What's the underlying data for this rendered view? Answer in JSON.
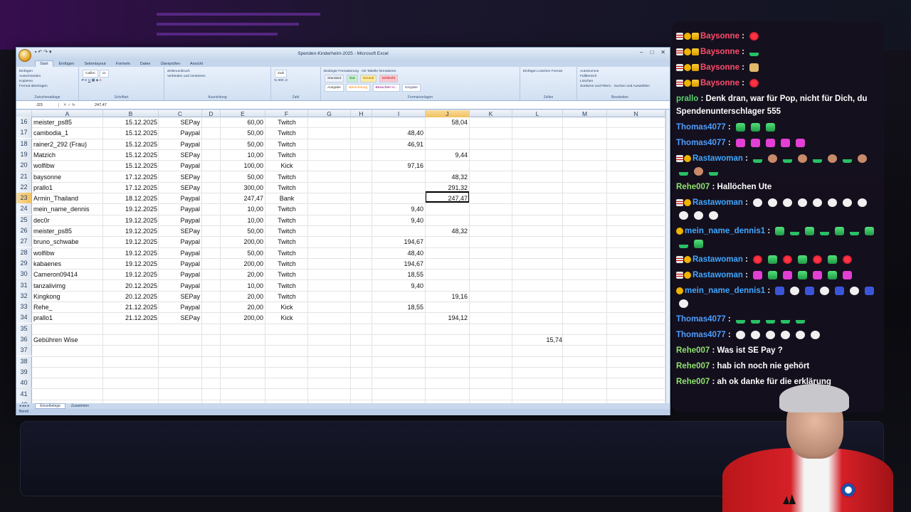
{
  "excel": {
    "title": "Spenden-Kinderheim-2025 - Microsoft Excel",
    "ribbon_tabs": [
      "Start",
      "Einfügen",
      "Seitenlayout",
      "Formeln",
      "Daten",
      "Überprüfen",
      "Ansicht"
    ],
    "clipboard": {
      "paste": "Einfügen",
      "cut": "Ausschneiden",
      "copy": "Kopieren",
      "format": "Format übertragen",
      "group": "Zwischenablage"
    },
    "font": {
      "name": "Calibri",
      "size": "11",
      "group": "Schriftart"
    },
    "alignment": {
      "wrap": "Zeilenumbruch",
      "merge": "Verbinden und zentrieren",
      "group": "Ausrichtung"
    },
    "number": {
      "format": "Zahl",
      "group": "Zahl"
    },
    "styles": {
      "cond": "Bedingte Formatierung",
      "table": "Als Tabelle formatieren",
      "standard": "Standard",
      "gut": "Gut",
      "neutral": "Neutral",
      "schlecht": "Schlecht",
      "ausgabe": "Ausgabe",
      "berechnung": "Berechnung",
      "besucht": "Besuchter H...",
      "eingabe": "Eingabe",
      "group": "Formatvorlagen"
    },
    "cells": {
      "insert": "Einfügen",
      "delete": "Löschen",
      "format": "Format",
      "group": "Zellen"
    },
    "editing": {
      "autosum": "AutoSumme",
      "fill": "Füllbereich",
      "clear": "Löschen",
      "sort": "Sortieren und Filtern",
      "find": "Suchen und Auswählen",
      "group": "Bearbeiten"
    },
    "namebox": "J23",
    "formula": "247,47",
    "columns": [
      "A",
      "B",
      "C",
      "D",
      "E",
      "F",
      "G",
      "H",
      "I",
      "J",
      "K",
      "L",
      "M",
      "N"
    ],
    "rows": [
      {
        "n": "16",
        "a": "meister_ps85",
        "b": "15.12.2025",
        "c": "SEPay",
        "e": "60,00",
        "f": "Twitch",
        "i": "",
        "j": "58,04",
        "l": ""
      },
      {
        "n": "17",
        "a": "cambodia_1",
        "b": "15.12.2025",
        "c": "Paypal",
        "e": "50,00",
        "f": "Twitch",
        "i": "48,40",
        "j": "",
        "l": ""
      },
      {
        "n": "18",
        "a": "rainer2_292 (Frau)",
        "b": "15.12.2025",
        "c": "Paypal",
        "e": "50,00",
        "f": "Twitch",
        "i": "46,91",
        "j": "",
        "l": ""
      },
      {
        "n": "19",
        "a": "Matzich",
        "b": "15.12.2025",
        "c": "SEPay",
        "e": "10,00",
        "f": "Twitch",
        "i": "",
        "j": "9,44",
        "l": ""
      },
      {
        "n": "20",
        "a": "wolfibw",
        "b": "15.12.2025",
        "c": "Paypal",
        "e": "100,00",
        "f": "Kick",
        "i": "97,16",
        "j": "",
        "l": ""
      },
      {
        "n": "21",
        "a": "baysonne",
        "b": "17.12.2025",
        "c": "SEPay",
        "e": "50,00",
        "f": "Twitch",
        "i": "",
        "j": "48,32",
        "l": ""
      },
      {
        "n": "22",
        "a": "prallo1",
        "b": "17.12.2025",
        "c": "SEPay",
        "e": "300,00",
        "f": "Twitch",
        "i": "",
        "j": "291,32",
        "l": ""
      },
      {
        "n": "23",
        "a": "Armin_Thailand",
        "b": "18.12.2025",
        "c": "Paypal",
        "e": "247,47",
        "f": "Bank",
        "i": "",
        "j": "247,47",
        "l": ""
      },
      {
        "n": "24",
        "a": "mein_name_dennis",
        "b": "19.12.2025",
        "c": "Paypal",
        "e": "10,00",
        "f": "Twitch",
        "i": "9,40",
        "j": "",
        "l": ""
      },
      {
        "n": "25",
        "a": "dec0r",
        "b": "19.12.2025",
        "c": "Paypal",
        "e": "10,00",
        "f": "Twitch",
        "i": "9,40",
        "j": "",
        "l": ""
      },
      {
        "n": "26",
        "a": "meister_ps85",
        "b": "19.12.2025",
        "c": "SEPay",
        "e": "50,00",
        "f": "Twitch",
        "i": "",
        "j": "48,32",
        "l": ""
      },
      {
        "n": "27",
        "a": "bruno_schwabe",
        "b": "19.12.2025",
        "c": "Paypal",
        "e": "200,00",
        "f": "Twitch",
        "i": "194,67",
        "j": "",
        "l": ""
      },
      {
        "n": "28",
        "a": "wolfibw",
        "b": "19.12.2025",
        "c": "Paypal",
        "e": "50,00",
        "f": "Twitch",
        "i": "48,40",
        "j": "",
        "l": ""
      },
      {
        "n": "29",
        "a": "kabaenes",
        "b": "19.12.2025",
        "c": "Paypal",
        "e": "200,00",
        "f": "Twitch",
        "i": "194,67",
        "j": "",
        "l": ""
      },
      {
        "n": "30",
        "a": "Cameron09414",
        "b": "19.12.2025",
        "c": "Paypal",
        "e": "20,00",
        "f": "Twitch",
        "i": "18,55",
        "j": "",
        "l": ""
      },
      {
        "n": "31",
        "a": "tanzalivimg",
        "b": "20.12.2025",
        "c": "Paypal",
        "e": "10,00",
        "f": "Twitch",
        "i": "9,40",
        "j": "",
        "l": ""
      },
      {
        "n": "32",
        "a": "Kingkong",
        "b": "20.12.2025",
        "c": "SEPay",
        "e": "20,00",
        "f": "Twitch",
        "i": "",
        "j": "19,16",
        "l": ""
      },
      {
        "n": "33",
        "a": "Rehe_",
        "b": "21.12.2025",
        "c": "Paypal",
        "e": "20,00",
        "f": "Kick",
        "i": "18,55",
        "j": "",
        "l": ""
      },
      {
        "n": "34",
        "a": "prallo1",
        "b": "21.12.2025",
        "c": "SEPay",
        "e": "200,00",
        "f": "Kick",
        "i": "",
        "j": "194,12",
        "l": ""
      },
      {
        "n": "35",
        "a": "",
        "b": "",
        "c": "",
        "e": "",
        "f": "",
        "i": "",
        "j": "",
        "l": ""
      },
      {
        "n": "36",
        "a": "Gebühren Wise",
        "b": "",
        "c": "",
        "e": "",
        "f": "",
        "i": "",
        "j": "",
        "l": "15,74"
      },
      {
        "n": "37",
        "a": "",
        "b": "",
        "c": "",
        "e": "",
        "f": "",
        "i": "",
        "j": "",
        "l": ""
      },
      {
        "n": "38",
        "a": "",
        "b": "",
        "c": "",
        "e": "",
        "f": "",
        "i": "",
        "j": "",
        "l": ""
      },
      {
        "n": "39",
        "a": "",
        "b": "",
        "c": "",
        "e": "",
        "f": "",
        "i": "",
        "j": "",
        "l": ""
      },
      {
        "n": "40",
        "a": "",
        "b": "",
        "c": "",
        "e": "",
        "f": "",
        "i": "",
        "j": "",
        "l": ""
      },
      {
        "n": "41",
        "a": "",
        "b": "",
        "c": "",
        "e": "",
        "f": "",
        "i": "",
        "j": "",
        "l": ""
      },
      {
        "n": "42",
        "a": "",
        "b": "",
        "c": "",
        "e": "",
        "f": "",
        "i": "",
        "j": "",
        "l": ""
      }
    ],
    "sheet_tabs": [
      "Einzelbelege",
      "Zusammen"
    ],
    "status": "Bereit"
  },
  "chat": [
    {
      "user": "Baysonne",
      "color": "#ff4d6d",
      "badges": [
        "mod",
        "sub",
        "crown"
      ],
      "text": "",
      "emotes": [
        "red"
      ]
    },
    {
      "user": "Baysonne",
      "color": "#ff4d6d",
      "badges": [
        "mod",
        "sub",
        "crown"
      ],
      "text": "",
      "emotes": [
        "grass"
      ]
    },
    {
      "user": "Baysonne",
      "color": "#ff4d6d",
      "badges": [
        "mod",
        "sub",
        "crown"
      ],
      "text": "",
      "emotes": [
        "hand"
      ]
    },
    {
      "user": "Baysonne",
      "color": "#ff4d6d",
      "badges": [
        "mod",
        "sub",
        "crown"
      ],
      "text": "",
      "emotes": [
        "red"
      ]
    },
    {
      "user": "prallo",
      "color": "#59d26f",
      "badges": [],
      "text": "Denk dran, war für Pop, nicht für Dich, du Spendenunterschlager 555",
      "emotes": []
    },
    {
      "user": "Thomas4077",
      "color": "#4d9dff",
      "badges": [],
      "text": "",
      "emotes": [
        "green",
        "green",
        "green"
      ]
    },
    {
      "user": "Thomas4077",
      "color": "#4d9dff",
      "badges": [],
      "text": "",
      "emotes": [
        "pink",
        "pink",
        "pink",
        "pink",
        "pink"
      ]
    },
    {
      "user": "Rastawoman",
      "color": "#3fa7ff",
      "badges": [
        "mod",
        "sub"
      ],
      "text": "",
      "emotes": [
        "grass",
        "face",
        "grass",
        "face",
        "grass",
        "face",
        "grass",
        "face",
        "grass",
        "face",
        "grass"
      ]
    },
    {
      "user": "Rehe007",
      "color": "#8fe36e",
      "badges": [],
      "text": "Hallöchen Ute",
      "emotes": []
    },
    {
      "user": "Rastawoman",
      "color": "#3fa7ff",
      "badges": [
        "mod",
        "sub"
      ],
      "text": "",
      "emotes": [
        "white",
        "white",
        "white",
        "white",
        "white",
        "white",
        "white",
        "white",
        "white",
        "white",
        "white"
      ]
    },
    {
      "user": "mein_name_dennis1",
      "color": "#3fa7ff",
      "badges": [
        "sub"
      ],
      "text": "",
      "emotes": [
        "green",
        "grass",
        "green",
        "grass",
        "green",
        "grass",
        "green",
        "grass",
        "green"
      ]
    },
    {
      "user": "Rastawoman",
      "color": "#3fa7ff",
      "badges": [
        "mod",
        "sub"
      ],
      "text": "",
      "emotes": [
        "red",
        "green",
        "red",
        "green",
        "red",
        "green",
        "red"
      ]
    },
    {
      "user": "Rastawoman",
      "color": "#3fa7ff",
      "badges": [
        "mod",
        "sub"
      ],
      "text": "",
      "emotes": [
        "pink",
        "green",
        "pink",
        "green",
        "pink",
        "green",
        "pink"
      ]
    },
    {
      "user": "mein_name_dennis1",
      "color": "#3fa7ff",
      "badges": [
        "sub"
      ],
      "text": "",
      "emotes": [
        "blue",
        "white",
        "blue",
        "white",
        "blue",
        "white",
        "blue",
        "white"
      ]
    },
    {
      "user": "Thomas4077",
      "color": "#4d9dff",
      "badges": [],
      "text": "",
      "emotes": [
        "grass",
        "grass",
        "grass",
        "grass",
        "grass"
      ]
    },
    {
      "user": "Thomas4077",
      "color": "#4d9dff",
      "badges": [],
      "text": "",
      "emotes": [
        "white",
        "white",
        "white",
        "white",
        "white",
        "white"
      ]
    },
    {
      "user": "Rehe007",
      "color": "#8fe36e",
      "badges": [],
      "text": "Was ist SE Pay ?",
      "emotes": []
    },
    {
      "user": "Rehe007",
      "color": "#8fe36e",
      "badges": [],
      "text": "hab ich noch nie gehört",
      "emotes": []
    },
    {
      "user": "Rehe007",
      "color": "#8fe36e",
      "badges": [],
      "text": "ah ok danke für die erklärung",
      "emotes": []
    }
  ]
}
